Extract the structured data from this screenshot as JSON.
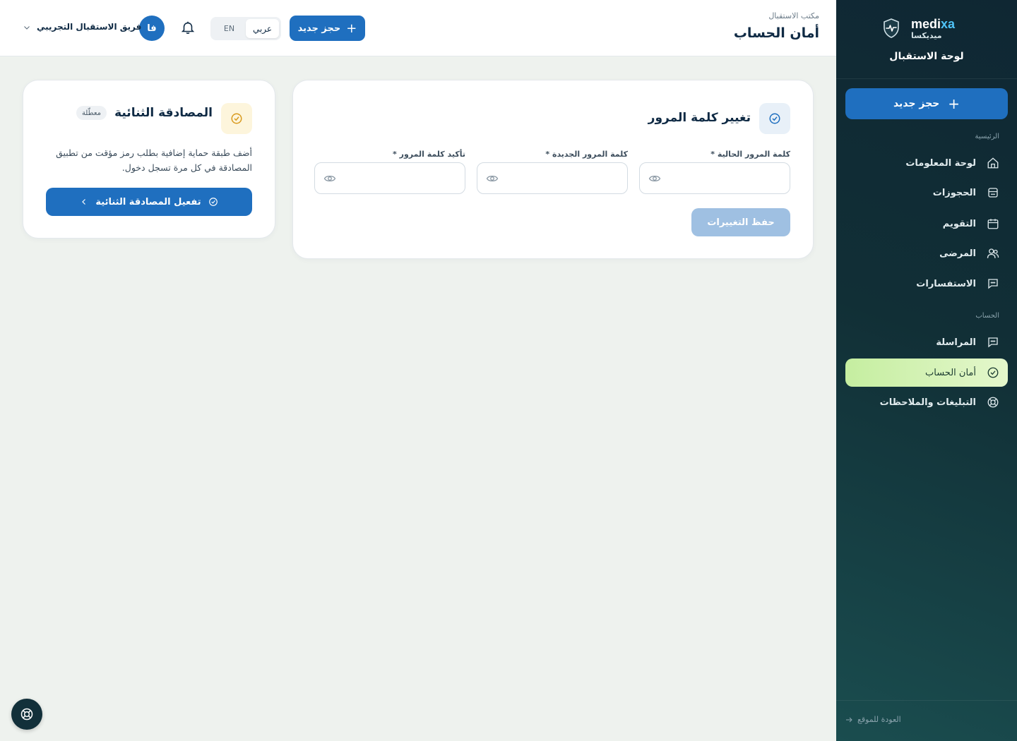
{
  "brand": {
    "name_en_main": "medi",
    "name_en_accent": "xa",
    "name_ar": "ميديكسا",
    "panel_title": "لوحة الاستقبال"
  },
  "sidebar": {
    "new_booking": "حجز جديد",
    "sections": [
      {
        "label": "الرئيسية"
      },
      {
        "label": "الحساب"
      }
    ],
    "items": [
      {
        "label": "لوحة المعلومات",
        "icon": "home-icon"
      },
      {
        "label": "الحجوزات",
        "icon": "bookings-icon"
      },
      {
        "label": "التقويم",
        "icon": "calendar-icon"
      },
      {
        "label": "المرضى",
        "icon": "users-icon"
      },
      {
        "label": "الاستفسارات",
        "icon": "chat-icon"
      },
      {
        "label": "المراسلة",
        "icon": "message-icon"
      },
      {
        "label": "أمان الحساب",
        "icon": "check-circle-icon",
        "active": true
      },
      {
        "label": "التبليغات والملاحظات",
        "icon": "lifebuoy-icon"
      }
    ],
    "back_to_site": "العودة للموقع"
  },
  "topbar": {
    "breadcrumb": "مكتب الاستقبال",
    "title": "أمان الحساب",
    "new_booking": "حجز جديد",
    "lang_ar": "عربي",
    "lang_en": "EN",
    "avatar_initials": "فا",
    "user_name": "فريق الاستقبال التجريبي"
  },
  "password_card": {
    "title": "تغيير كلمة المرور",
    "fields": [
      {
        "label": "كلمة المرور الحالية *",
        "value": "",
        "placeholder": ""
      },
      {
        "label": "كلمة المرور الجديدة *",
        "value": "",
        "placeholder": ""
      },
      {
        "label": "تأكيد كلمة المرور *",
        "value": "",
        "placeholder": ""
      }
    ],
    "save_label": "حفظ التغييرات"
  },
  "twofa_card": {
    "title": "المصادقة الثنائية",
    "status_badge": "معطّلة",
    "description": "أضف طبقة حماية إضافية بطلب رمز مؤقت من تطبيق المصادقة في كل مرة تسجل دخول.",
    "activate_label": "تفعيل المصادقة الثنائية"
  },
  "colors": {
    "primary": "#1f6fbf",
    "primary_disabled": "#9fc0e2",
    "active_nav": "#c5eea0",
    "sidebar_bg": "#0f2733",
    "warning_tile": "#fdf5dc"
  }
}
